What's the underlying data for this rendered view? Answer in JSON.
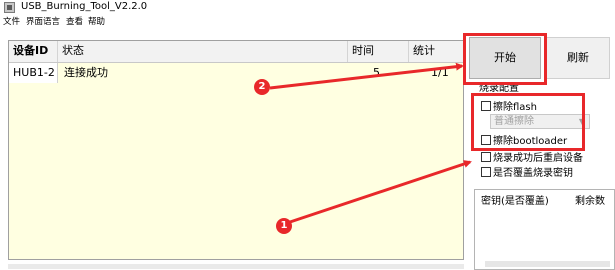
{
  "window": {
    "title": "USB_Burning_Tool_V2.2.0",
    "icon": "app-icon"
  },
  "menu": {
    "items": [
      "文件",
      "界面语言",
      "查看",
      "帮助"
    ]
  },
  "table": {
    "headers": [
      "设备ID",
      "状态",
      "时间",
      "统计"
    ],
    "rows": [
      {
        "device_id": "HUB1-2",
        "status": "连接成功",
        "time": "5",
        "count": "1/1"
      }
    ]
  },
  "buttons": {
    "start": "开始",
    "refresh": "刷新"
  },
  "options": {
    "group_label": "烧录配置",
    "erase_flash": {
      "label": "擦除flash",
      "checked": false
    },
    "erase_mode": {
      "value": "普通擦除",
      "enabled": false
    },
    "erase_bootloader": {
      "label": "擦除bootloader",
      "checked": false
    },
    "reboot_after": {
      "label": "烧录成功后重启设备",
      "checked": false
    },
    "overwrite_key": {
      "label": "是否覆盖烧录密钥",
      "checked": false
    }
  },
  "key_list": {
    "headers": [
      "密钥(是否覆盖)",
      "剩余数"
    ]
  },
  "annotations": {
    "badge_1": "1",
    "badge_2": "2",
    "highlight_color": "#e8282a"
  }
}
